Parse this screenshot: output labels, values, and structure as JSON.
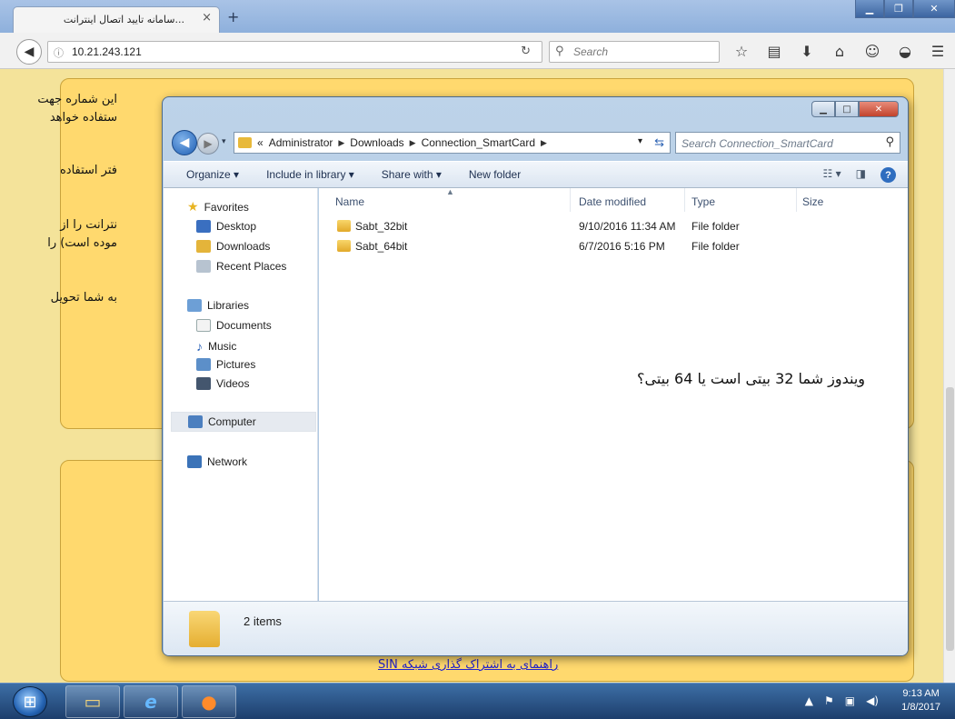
{
  "browser": {
    "tab_title": "...سامانه تایید اتصال اینترانت",
    "tab_close": "×",
    "new_tab": "+",
    "url": "10.21.243.121",
    "search_placeholder": "Search"
  },
  "page": {
    "text_line1": "این شماره جهت",
    "text_line2": "ستفاده خواهد",
    "text_line3": "فتر استفاده",
    "text_line4": "نترانت را از",
    "text_line5": "موده است) را",
    "text_line6": "به شما تحویل",
    "footer_link": "راهنمای به اشتراک گذاری شبکه SIN"
  },
  "explorer": {
    "breadcrumb": [
      "«",
      "Administrator",
      "Downloads",
      "Connection_SmartCard"
    ],
    "search_placeholder": "Search Connection_SmartCard",
    "toolbar": {
      "organize": "Organize ▾",
      "include": "Include in library ▾",
      "share": "Share with ▾",
      "new_folder": "New folder"
    },
    "nav": {
      "favorites": "Favorites",
      "desktop": "Desktop",
      "downloads": "Downloads",
      "recent": "Recent Places",
      "libraries": "Libraries",
      "documents": "Documents",
      "music": "Music",
      "pictures": "Pictures",
      "videos": "Videos",
      "computer": "Computer",
      "network": "Network"
    },
    "columns": {
      "name": "Name",
      "date": "Date modified",
      "type": "Type",
      "size": "Size"
    },
    "files": [
      {
        "name": "Sabt_32bit",
        "date": "9/10/2016 11:34 AM",
        "type": "File folder"
      },
      {
        "name": "Sabt_64bit",
        "date": "6/7/2016 5:16 PM",
        "type": "File folder"
      }
    ],
    "overlay_note": "ویندوز شما 32 بیتی است یا 64 بیتی؟",
    "details_count": "2 items"
  },
  "taskbar": {
    "time": "9:13 AM",
    "date": "1/8/2017"
  },
  "colors": {
    "page_bg": "#f4e39a",
    "panel": "#ffd96e",
    "taskbar": "#1d3e6c"
  }
}
